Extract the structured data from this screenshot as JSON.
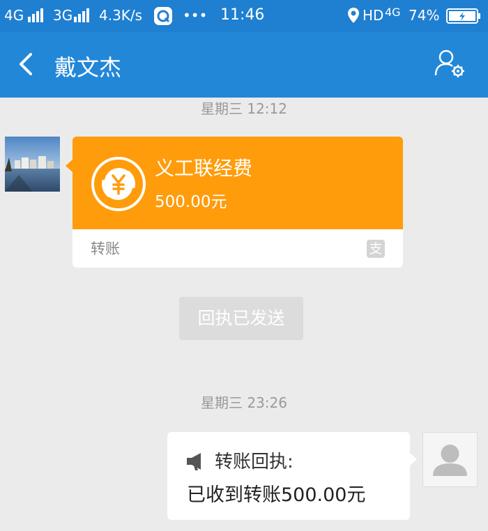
{
  "status_bar": {
    "network1": "4G",
    "network2": "3G",
    "speed": "4.3K/s",
    "more": "•••",
    "time": "11:46",
    "hd": "HD",
    "network3": "4G",
    "battery": "74%"
  },
  "header": {
    "title": "戴文杰"
  },
  "messages": {
    "time1": "星期三 12:12",
    "transfer": {
      "name": "义工联经费",
      "amount": "500.00元",
      "type": "转账",
      "logo_char": "支"
    },
    "receipt_button": "回执已发送",
    "time2": "星期三 23:26",
    "receipt": {
      "title": "转账回执:",
      "text": "已收到转账500.00元"
    }
  },
  "icons": {
    "back": "chevron-left-icon",
    "user_settings": "user-settings-icon",
    "transfer": "yuan-transfer-icon",
    "alipay": "alipay-icon",
    "speaker": "speaker-icon"
  },
  "colors": {
    "header": "#2387d8",
    "status_bar": "#1f7fd1",
    "transfer_card": "#ff9c0c",
    "background": "#ebebeb"
  }
}
